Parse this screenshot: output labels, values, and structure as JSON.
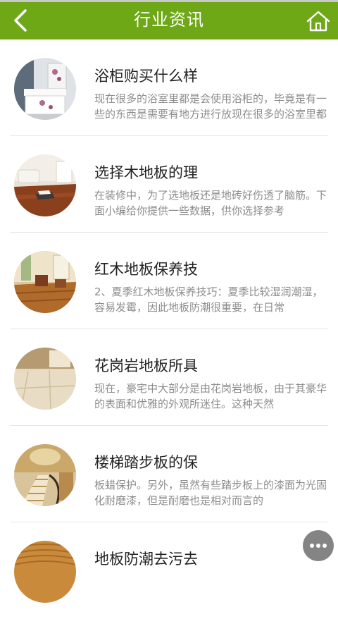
{
  "header": {
    "title": "行业资讯",
    "accent_color": "#6fa817",
    "back_icon": "chevron-left-icon",
    "home_icon": "home-icon"
  },
  "articles": [
    {
      "title": "浴柜购买什么样",
      "summary": "现在很多的浴室里都是会使用浴柜的，毕竟是有一些的东西是需要有地方进行放现在很多的浴室里都是会使用浴柜的",
      "image": "bathroom-cabinet-photo"
    },
    {
      "title": "选择木地板的理",
      "summary": "在装修中，为了选地板还是地砖好伤透了脑筋。下面小编给你提供一些数据，供你选择参考",
      "image": "living-room-wood-floor-photo"
    },
    {
      "title": "红木地板保养技",
      "summary": "2、夏季红木地板保养技巧：夏季比较湿润潮湿，容易发霉，因此地板防潮很重要，在日常",
      "image": "redwood-floor-room-photo"
    },
    {
      "title": "花岗岩地板所具",
      "summary": "现在，豪宅中大部分是由花岗岩地板，由于其豪华的表面和优雅的外观所迷住。这种天然",
      "image": "granite-floor-photo"
    },
    {
      "title": "楼梯踏步板的保",
      "summary": "板蜡保护。另外，虽然有些踏步板上的漆面为光固化耐磨漆，但是耐磨也是相对而言的",
      "image": "staircase-photo"
    },
    {
      "title": "地板防潮去污去",
      "summary": "",
      "image": "wood-grain-photo"
    }
  ],
  "more_button": {
    "icon": "more-dots-icon"
  }
}
